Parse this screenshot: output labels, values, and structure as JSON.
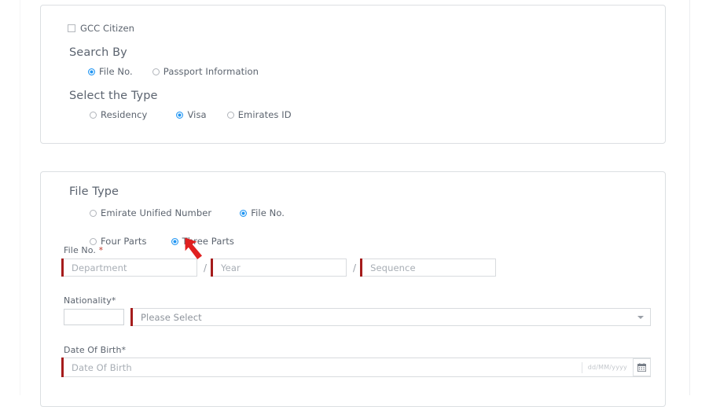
{
  "form": {
    "gcc_checkbox_label": "GCC Citizen",
    "search_by": {
      "heading": "Search By",
      "options": [
        {
          "label": "File No.",
          "selected": true
        },
        {
          "label": "Passport Information",
          "selected": false
        }
      ]
    },
    "select_type": {
      "heading": "Select the Type",
      "options": [
        {
          "label": "Residency",
          "selected": false
        },
        {
          "label": "Visa",
          "selected": true
        },
        {
          "label": "Emirates ID",
          "selected": false
        }
      ]
    },
    "file_type": {
      "heading": "File Type",
      "number_options": [
        {
          "label": "Emirate Unified Number",
          "selected": false
        },
        {
          "label": "File No.",
          "selected": true
        }
      ],
      "parts_options": [
        {
          "label": "Four Parts",
          "selected": false
        },
        {
          "label": "Three Parts",
          "selected": true
        }
      ],
      "file_no_label": "File No. ",
      "required_mark": "*",
      "separator": "/",
      "inputs": [
        {
          "placeholder": "Department",
          "value": ""
        },
        {
          "placeholder": "Year",
          "value": ""
        },
        {
          "placeholder": "Sequence",
          "value": ""
        }
      ]
    },
    "nationality": {
      "label": "Nationality*",
      "selected_value": "Please Select"
    },
    "date_of_birth": {
      "label": "Date Of Birth*",
      "placeholder": "Date Of Birth",
      "format_hint": "dd/MM/yyyy",
      "calendar_icon": "calendar-icon"
    }
  },
  "annotation": {
    "arrow_icon": "red-arrow-up-left",
    "arrow_color": "#e02020",
    "points_at": "Three Parts"
  },
  "colors": {
    "radio_selected": "#2196f3",
    "required_bar": "#a51c1c",
    "required_asterisk": "#c0392b",
    "panel_border": "#dcdfe2",
    "text": "#5b636e"
  }
}
